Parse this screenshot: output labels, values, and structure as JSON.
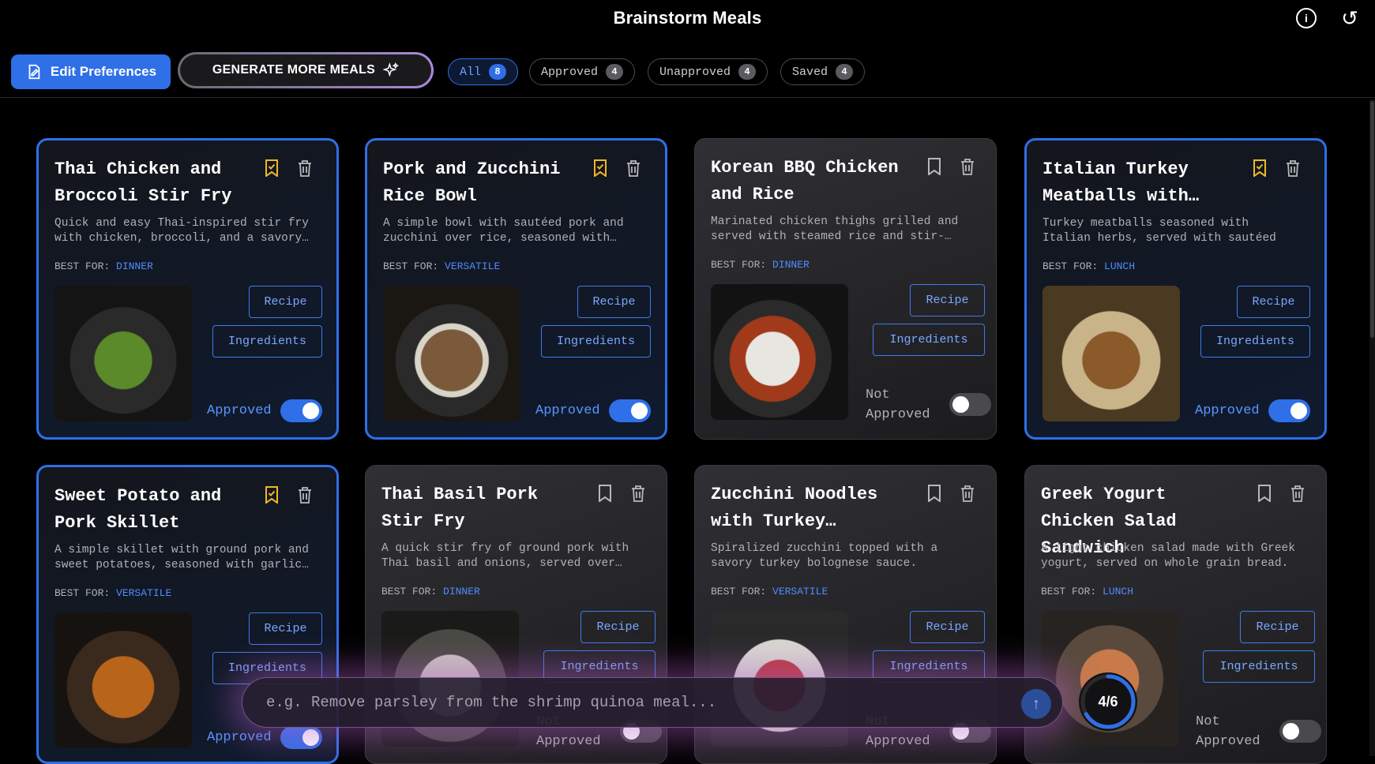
{
  "app": {
    "title": "Brainstorm Meals"
  },
  "header": {
    "edit_label": "Edit Preferences",
    "generate_label": "GENERATE MORE MEALS",
    "filters": [
      {
        "label": "All",
        "count": "8",
        "active": true
      },
      {
        "label": "Approved",
        "count": "4",
        "active": false
      },
      {
        "label": "Unapproved",
        "count": "4",
        "active": false
      },
      {
        "label": "Saved",
        "count": "4",
        "active": false
      }
    ]
  },
  "common": {
    "best_for_label": "BEST FOR:",
    "recipe_label": "Recipe",
    "ingredients_label": "Ingredients",
    "approved_label": "Approved",
    "not_approved_label": "Not Approved"
  },
  "meals": [
    {
      "title": "Thai Chicken and Broccoli Stir Fry",
      "description": "Quick and easy Thai-inspired stir fry with chicken, broccoli, and a savory…",
      "best_for": "DINNER",
      "approved": true,
      "saved": true
    },
    {
      "title": "Pork and Zucchini Rice Bowl",
      "description": "A simple bowl with sautéed pork and zucchini over rice, seasoned with…",
      "best_for": "VERSATILE",
      "approved": true,
      "saved": true
    },
    {
      "title": "Korean BBQ Chicken and Rice",
      "description": "Marinated chicken thighs grilled and served with steamed rice and stir-…",
      "best_for": "DINNER",
      "approved": false,
      "saved": false
    },
    {
      "title": "Italian Turkey Meatballs with…",
      "description": "Turkey meatballs seasoned with Italian herbs, served with sautéed zucchini.",
      "best_for": "LUNCH",
      "approved": true,
      "saved": true
    },
    {
      "title": "Sweet Potato and Pork Skillet",
      "description": "A simple skillet with ground pork and sweet potatoes, seasoned with garlic…",
      "best_for": "VERSATILE",
      "approved": true,
      "saved": true
    },
    {
      "title": "Thai Basil Pork Stir Fry",
      "description": "A quick stir fry of ground pork with Thai basil and onions, served over…",
      "best_for": "DINNER",
      "approved": false,
      "saved": false
    },
    {
      "title": "Zucchini Noodles with Turkey…",
      "description": "Spiralized zucchini topped with a savory turkey bolognese sauce.",
      "best_for": "VERSATILE",
      "approved": false,
      "saved": false
    },
    {
      "title": "Greek Yogurt Chicken Salad Sandwich",
      "description": "A light chicken salad made with Greek yogurt, served on whole grain bread.",
      "best_for": "LUNCH",
      "approved": false,
      "saved": false
    }
  ],
  "prompt": {
    "placeholder": "e.g. Remove parsley from the shrimp quinoa meal..."
  },
  "progress": {
    "current": "4",
    "total": "6",
    "text": "4/6"
  },
  "icons": [
    "edit-icon",
    "sparkle-icon",
    "info-icon",
    "reset-icon",
    "bookmark-icon",
    "trash-icon",
    "send-icon"
  ],
  "colors": {
    "accent": "#2f6fe8",
    "saved": "#f2b824",
    "best_for": "#4f8cff",
    "glow": "#b45ac8"
  }
}
